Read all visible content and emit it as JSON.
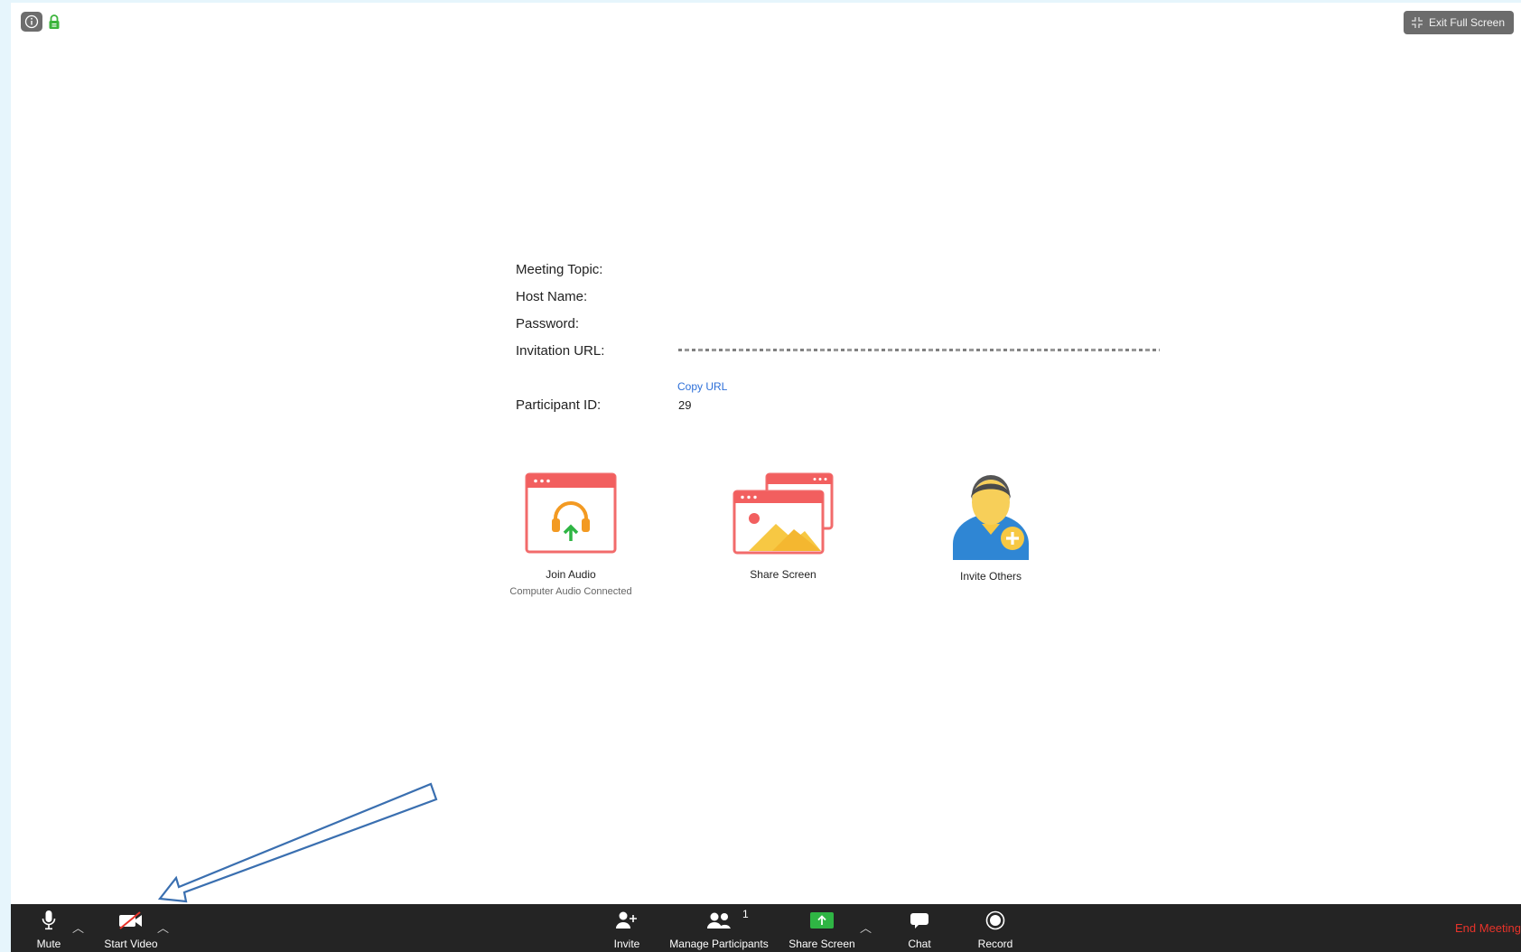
{
  "top_bar": {
    "exit_full_screen": "Exit Full Screen"
  },
  "meeting_info": {
    "rows": [
      {
        "label": "Meeting Topic:",
        "value": ""
      },
      {
        "label": "Host Name:",
        "value": ""
      },
      {
        "label": "Password:",
        "value": ""
      },
      {
        "label": "Invitation URL:",
        "value": ""
      },
      {
        "label": "Participant ID:",
        "value": "29"
      }
    ],
    "copy_url": "Copy URL"
  },
  "actions": [
    {
      "label": "Join Audio",
      "sublabel": "Computer Audio Connected",
      "icon": "headset-upload-icon"
    },
    {
      "label": "Share Screen",
      "sublabel": "",
      "icon": "share-screen-window-icon"
    },
    {
      "label": "Invite Others",
      "sublabel": "",
      "icon": "person-add-icon"
    }
  ],
  "toolbar": {
    "mute": "Mute",
    "start_video": "Start Video",
    "invite": "Invite",
    "manage_participants": "Manage Participants",
    "participants_count": "1",
    "share_screen": "Share Screen",
    "chat": "Chat",
    "record": "Record",
    "end_meeting": "End Meeting"
  },
  "colors": {
    "accent_blue": "#2d6fd8",
    "share_green": "#2fb544",
    "end_red": "#e8332a",
    "toolbar_bg": "#242424",
    "annotation_arrow": "#3a6fb0"
  }
}
